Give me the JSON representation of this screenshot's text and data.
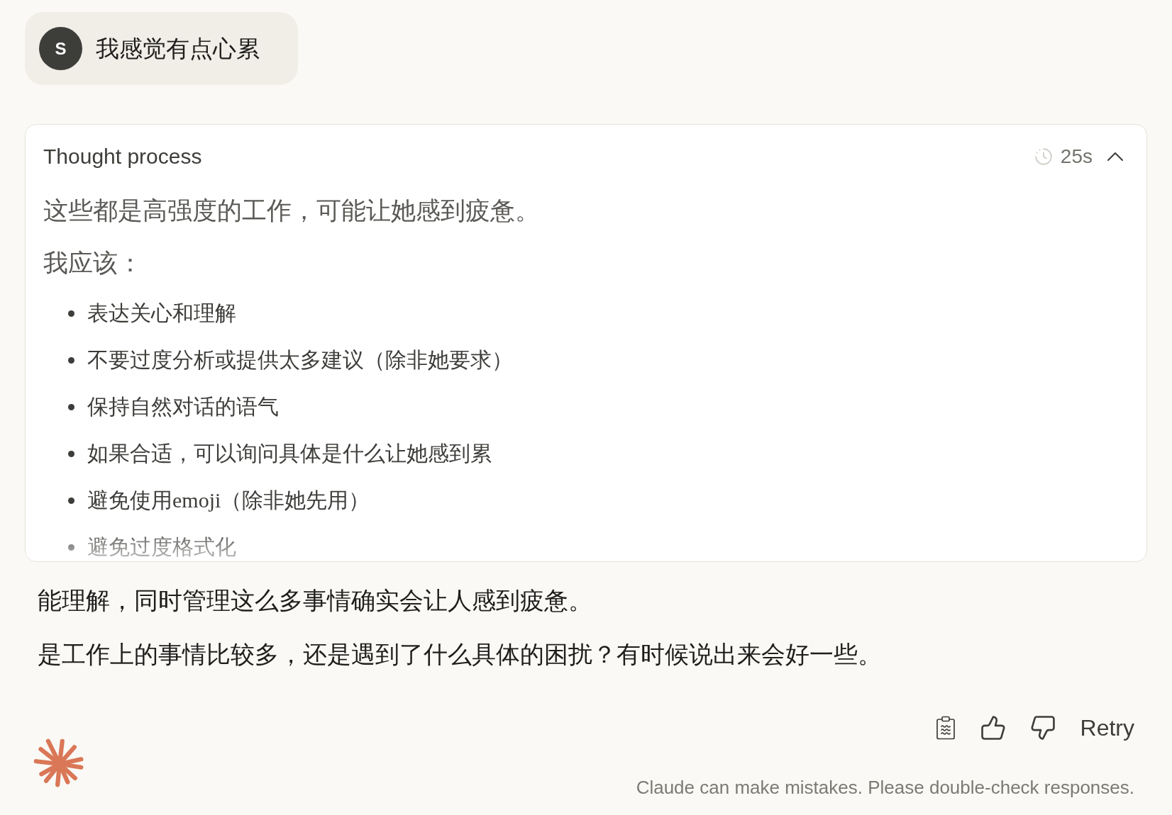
{
  "user_message": {
    "avatar_initial": "S",
    "text": "我感觉有点心累"
  },
  "thought_process": {
    "title": "Thought process",
    "duration": "25s",
    "expanded": true,
    "paragraphs": [
      "这些都是高强度的工作，可能让她感到疲惫。",
      "我应该："
    ],
    "bullets": [
      "表达关心和理解",
      "不要过度分析或提供太多建议（除非她要求）",
      "保持自然对话的语气",
      "如果合适，可以询问具体是什么让她感到累",
      "避免使用emoji（除非她先用）",
      "避免过度格式化"
    ]
  },
  "response": {
    "paragraphs": [
      "能理解，同时管理这么多事情确实会让人感到疲惫。",
      "是工作上的事情比较多，还是遇到了什么具体的困扰？有时候说出来会好一些。"
    ]
  },
  "actions": [
    {
      "kind": "copy"
    },
    {
      "kind": "thumbs_up"
    },
    {
      "kind": "thumbs_down"
    },
    {
      "kind": "retry",
      "label": "Retry"
    }
  ],
  "disclaimer": "Claude can make mistakes. Please double-check responses."
}
